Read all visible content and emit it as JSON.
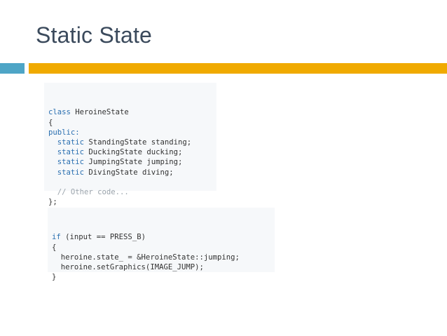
{
  "slide": {
    "title": "Static State",
    "accent_colors": {
      "bar_left": "#4ea5c6",
      "bar_right": "#f0aa00"
    }
  },
  "code_block_1": {
    "lines": [
      [
        {
          "t": "class",
          "kw": true
        },
        {
          "t": " HeroineState"
        }
      ],
      [
        {
          "t": "{"
        }
      ],
      [
        {
          "t": "public:",
          "kw": true
        }
      ],
      [
        {
          "t": "  "
        },
        {
          "t": "static",
          "kw": true
        },
        {
          "t": " StandingState standing;"
        }
      ],
      [
        {
          "t": "  "
        },
        {
          "t": "static",
          "kw": true
        },
        {
          "t": " DuckingState ducking;"
        }
      ],
      [
        {
          "t": "  "
        },
        {
          "t": "static",
          "kw": true
        },
        {
          "t": " JumpingState jumping;"
        }
      ],
      [
        {
          "t": "  "
        },
        {
          "t": "static",
          "kw": true
        },
        {
          "t": " DivingState diving;"
        }
      ],
      [
        {
          "t": ""
        }
      ],
      [
        {
          "t": "  "
        },
        {
          "t": "// Other code...",
          "cm": true
        }
      ],
      [
        {
          "t": "};"
        }
      ]
    ]
  },
  "code_block_2": {
    "lines": [
      [
        {
          "t": "if",
          "kw": true
        },
        {
          "t": " (input == PRESS_B)"
        }
      ],
      [
        {
          "t": "{"
        }
      ],
      [
        {
          "t": "  heroine.state_ = &HeroineState::jumping;"
        }
      ],
      [
        {
          "t": "  heroine.setGraphics(IMAGE_JUMP);"
        }
      ],
      [
        {
          "t": "}"
        }
      ]
    ]
  }
}
